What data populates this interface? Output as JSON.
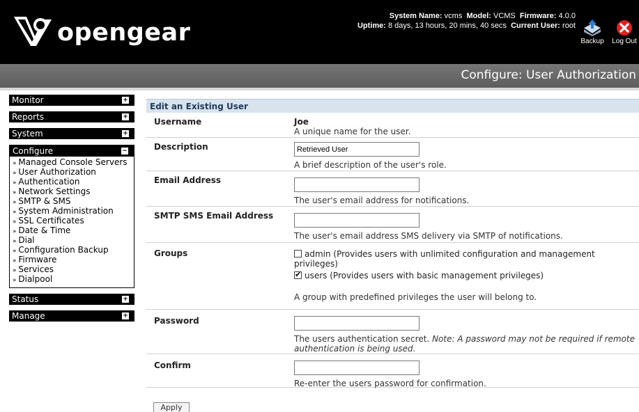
{
  "brand": {
    "logo_text": "opengear"
  },
  "system_info": {
    "system_name_label": "System Name:",
    "system_name": "vcms",
    "model_label": "Model:",
    "model": "VCMS",
    "firmware_label": "Firmware:",
    "firmware": "4.0.0",
    "uptime_label": "Uptime:",
    "uptime": "8 days, 13 hours, 20 mins, 40 secs",
    "current_user_label": "Current User:",
    "current_user": "root"
  },
  "header_buttons": {
    "backup_label": "Backup",
    "logout_label": "Log Out"
  },
  "page_title": "Configure: User Authorization",
  "sidebar": {
    "monitor": "Monitor",
    "reports": "Reports",
    "system": "System",
    "configure": "Configure",
    "configure_items": [
      "Managed Console Servers",
      "User Authorization",
      "Authentication",
      "Network Settings",
      "SMTP & SMS",
      "System Administration",
      "SSL Certificates",
      "Date & Time",
      "Dial",
      "Configuration Backup",
      "Firmware",
      "Services",
      "Dialpool"
    ],
    "status": "Status",
    "manage": "Manage",
    "collapsed_toggle": "+",
    "expanded_toggle": "−"
  },
  "form": {
    "section_title": "Edit an Existing User",
    "username_label": "Username",
    "username_value": "Joe",
    "username_help": "A unique name for the user.",
    "description_label": "Description",
    "description_value": "Retrieved User",
    "description_help": "A brief description of the user's role.",
    "email_label": "Email Address",
    "email_value": "",
    "email_help": "The user's email address for notifications.",
    "smtp_label": "SMTP SMS Email Address",
    "smtp_value": "",
    "smtp_help": "The user's email address SMS delivery via SMTP of notifications.",
    "groups_label": "Groups",
    "group_admin": "admin (Provides users with unlimited configuration and management privileges)",
    "group_admin_checked": false,
    "group_users": "users (Provides users with basic management privileges)",
    "group_users_checked": true,
    "groups_help": "A group with predefined privileges the user will belong to.",
    "password_label": "Password",
    "password_help": "The users authentication secret.",
    "password_note": "Note: A password may not be required if remote authentication is being used.",
    "confirm_label": "Confirm",
    "confirm_help": "Re-enter the users password for confirmation.",
    "apply_label": "Apply"
  }
}
